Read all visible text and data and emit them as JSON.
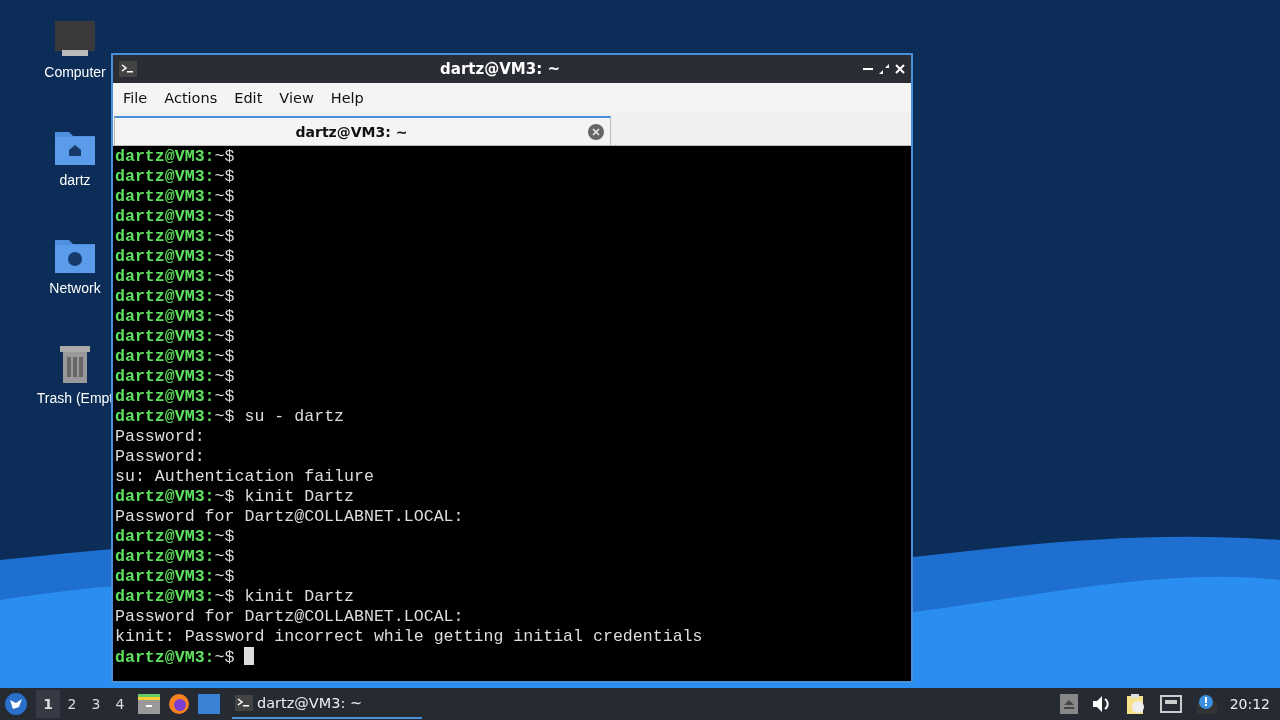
{
  "desktop": {
    "icons": [
      {
        "kind": "computer",
        "label": "Computer"
      },
      {
        "kind": "home",
        "label": "dartz"
      },
      {
        "kind": "network",
        "label": "Network"
      },
      {
        "kind": "trash",
        "label": "Trash (Empt"
      }
    ]
  },
  "window": {
    "title": "dartz@VM3: ~",
    "menu": [
      "File",
      "Actions",
      "Edit",
      "View",
      "Help"
    ],
    "tabs": [
      {
        "label": "dartz@VM3: ~",
        "selected": true
      }
    ],
    "terminal": {
      "lines": [
        {
          "kind": "prompt",
          "user": "dartz@VM3:",
          "path": "~$"
        },
        {
          "kind": "prompt",
          "user": "dartz@VM3:",
          "path": "~$"
        },
        {
          "kind": "prompt",
          "user": "dartz@VM3:",
          "path": "~$"
        },
        {
          "kind": "prompt",
          "user": "dartz@VM3:",
          "path": "~$"
        },
        {
          "kind": "prompt",
          "user": "dartz@VM3:",
          "path": "~$"
        },
        {
          "kind": "prompt",
          "user": "dartz@VM3:",
          "path": "~$"
        },
        {
          "kind": "prompt",
          "user": "dartz@VM3:",
          "path": "~$"
        },
        {
          "kind": "prompt",
          "user": "dartz@VM3:",
          "path": "~$"
        },
        {
          "kind": "prompt",
          "user": "dartz@VM3:",
          "path": "~$"
        },
        {
          "kind": "prompt",
          "user": "dartz@VM3:",
          "path": "~$"
        },
        {
          "kind": "prompt",
          "user": "dartz@VM3:",
          "path": "~$"
        },
        {
          "kind": "prompt",
          "user": "dartz@VM3:",
          "path": "~$"
        },
        {
          "kind": "prompt",
          "user": "dartz@VM3:",
          "path": "~$"
        },
        {
          "kind": "prompt",
          "user": "dartz@VM3:",
          "path": "~$",
          "command": "su - dartz"
        },
        {
          "kind": "output",
          "text": "Password:"
        },
        {
          "kind": "output",
          "text": "Password:"
        },
        {
          "kind": "output",
          "text": "su: Authentication failure"
        },
        {
          "kind": "prompt",
          "user": "dartz@VM3:",
          "path": "~$",
          "command": "kinit Dartz"
        },
        {
          "kind": "output",
          "text": "Password for Dartz@COLLABNET.LOCAL:"
        },
        {
          "kind": "prompt",
          "user": "dartz@VM3:",
          "path": "~$"
        },
        {
          "kind": "prompt",
          "user": "dartz@VM3:",
          "path": "~$"
        },
        {
          "kind": "prompt",
          "user": "dartz@VM3:",
          "path": "~$"
        },
        {
          "kind": "prompt",
          "user": "dartz@VM3:",
          "path": "~$",
          "command": "kinit Dartz"
        },
        {
          "kind": "output",
          "text": "Password for Dartz@COLLABNET.LOCAL:"
        },
        {
          "kind": "output",
          "text": "kinit: Password incorrect while getting initial credentials"
        },
        {
          "kind": "prompt",
          "user": "dartz@VM3:",
          "path": "~$",
          "cursor": true
        }
      ]
    }
  },
  "taskbar": {
    "workspaces": [
      {
        "label": "1",
        "selected": true
      },
      {
        "label": "2",
        "selected": false
      },
      {
        "label": "3",
        "selected": false
      },
      {
        "label": "4",
        "selected": false
      }
    ],
    "launchers": [
      {
        "kind": "files"
      },
      {
        "kind": "browser"
      },
      {
        "kind": "desktop"
      }
    ],
    "tasks": [
      {
        "label": "dartz@VM3: ~",
        "selected": true
      }
    ],
    "tray": [
      {
        "kind": "eject"
      },
      {
        "kind": "volume"
      },
      {
        "kind": "clipboard"
      },
      {
        "kind": "network"
      },
      {
        "kind": "notification"
      }
    ],
    "clock": "20:12"
  }
}
